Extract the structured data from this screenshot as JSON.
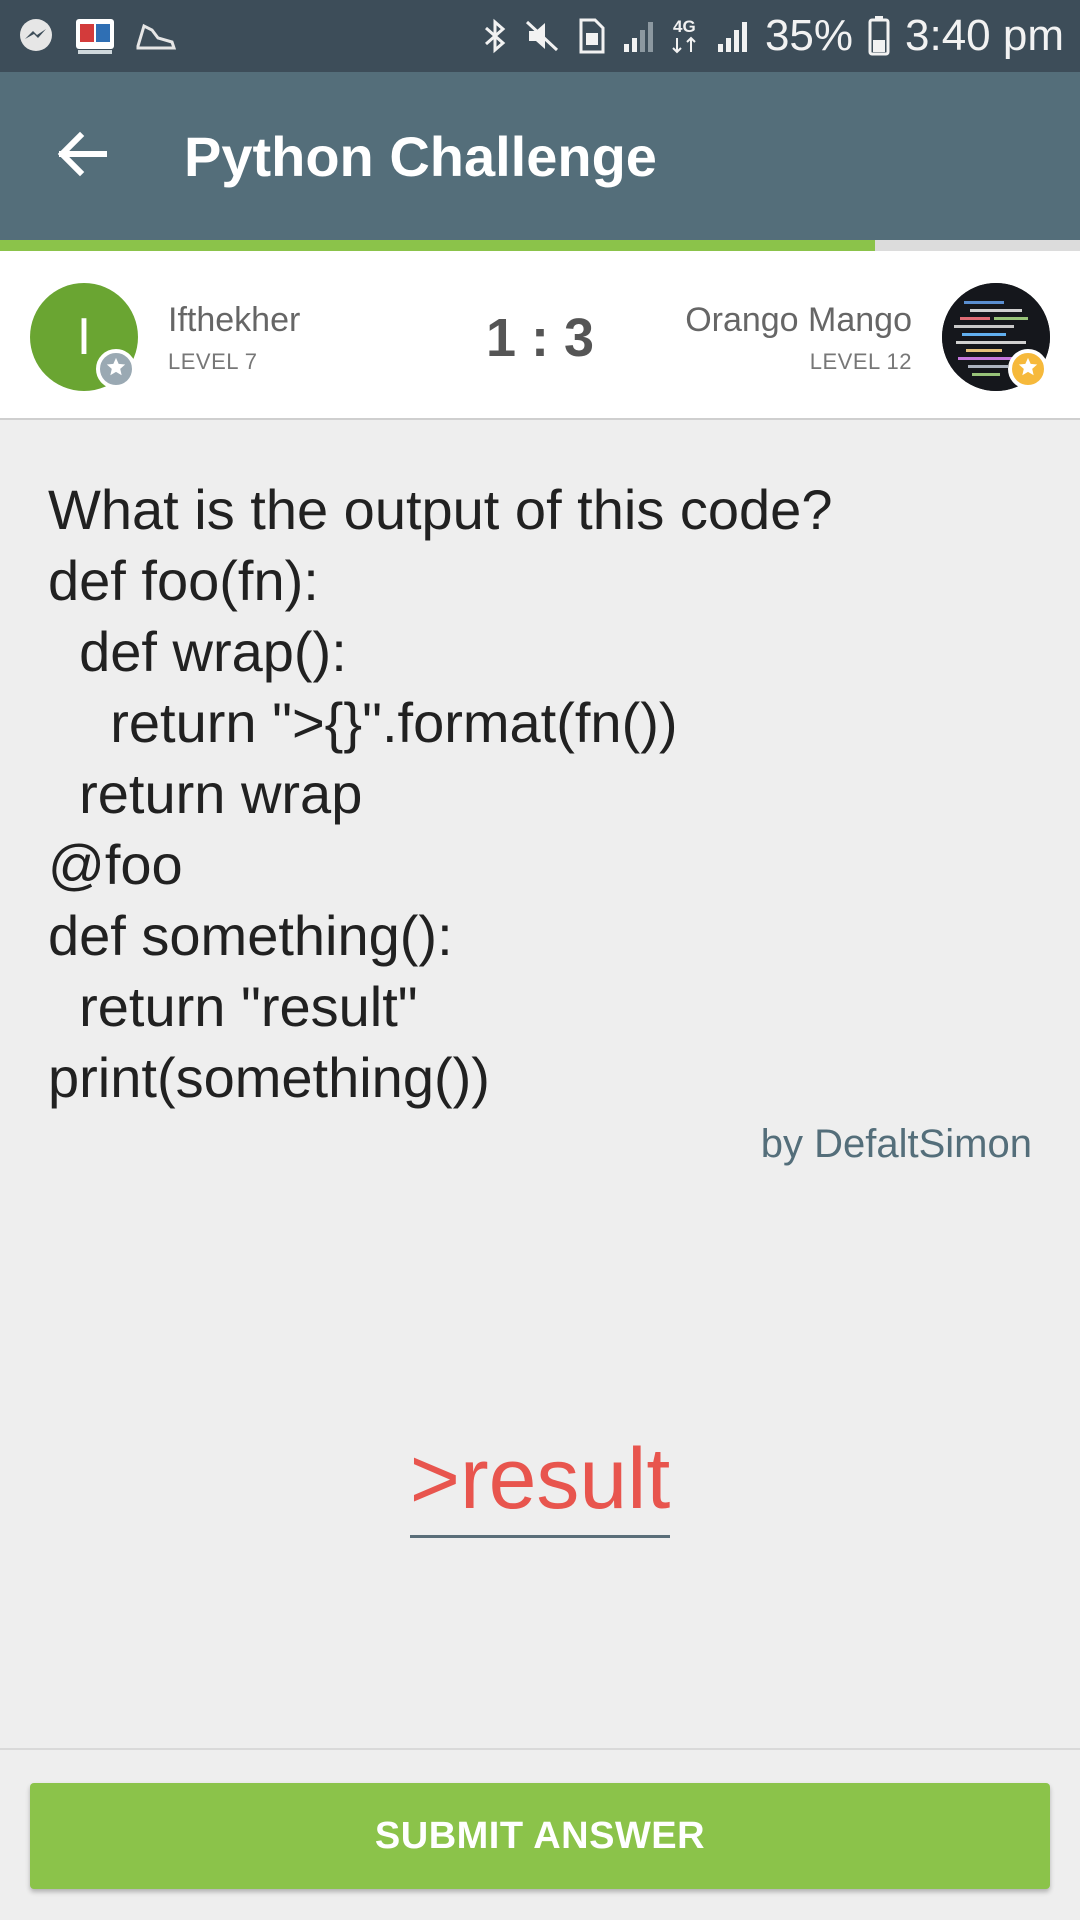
{
  "status_bar": {
    "battery": "35%",
    "time": "3:40 pm",
    "network": "4G",
    "icons_left": [
      "messenger-icon",
      "library-icon",
      "sneaker-icon"
    ],
    "icons_right": [
      "bluetooth-icon",
      "mute-icon",
      "sim-icon",
      "signal-icon",
      "signal-icon",
      "battery-icon"
    ]
  },
  "app_bar": {
    "title": "Python Challenge",
    "back_icon": "arrow-left-icon"
  },
  "progress": {
    "fraction": 0.81,
    "color": "#8bc34a"
  },
  "players": {
    "left": {
      "initial": "I",
      "name": "Ifthekher",
      "level": "LEVEL 7",
      "badge": "star-icon",
      "avatar_color": "#6aa532"
    },
    "score": "1 : 3",
    "right": {
      "name": "Orango Mango",
      "level": "LEVEL 12",
      "badge": "star-icon"
    }
  },
  "question": {
    "lines": [
      "What is the output of this code?",
      "def foo(fn):",
      "  def wrap():",
      "    return \">{}\".format(fn())",
      "  return wrap",
      "@foo",
      "def something():",
      "  return \"result\"",
      "print(something())"
    ],
    "author": "by DefaltSimon"
  },
  "answer": {
    "value": ">result",
    "color": "#e8554e"
  },
  "submit": {
    "label": "SUBMIT ANSWER",
    "color": "#8bc34a"
  }
}
